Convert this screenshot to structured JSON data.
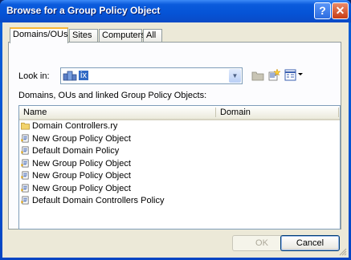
{
  "window": {
    "title": "Browse for a Group Policy Object",
    "help_button": "?",
    "close_button": "✕"
  },
  "tabs": [
    {
      "label": "Domains/OUs",
      "active": true
    },
    {
      "label": "Sites",
      "active": false
    },
    {
      "label": "Computers",
      "active": false
    },
    {
      "label": "All",
      "active": false
    }
  ],
  "look_in": {
    "label": "Look in:",
    "value": "ix"
  },
  "list_label": "Domains, OUs and linked Group Policy Objects:",
  "columns": [
    "Name",
    "Domain"
  ],
  "rows": [
    {
      "icon": "folder-icon",
      "name": "Domain Controllers.ry"
    },
    {
      "icon": "gpo-icon",
      "name": "New Group Policy Object"
    },
    {
      "icon": "gpo-icon",
      "name": "Default Domain Policy"
    },
    {
      "icon": "gpo-icon",
      "name": "New Group Policy Object"
    },
    {
      "icon": "gpo-icon",
      "name": "New Group Policy Object"
    },
    {
      "icon": "gpo-icon",
      "name": "New Group Policy Object"
    },
    {
      "icon": "gpo-icon",
      "name": "Default Domain Controllers Policy"
    }
  ],
  "buttons": {
    "ok": "OK",
    "cancel": "Cancel"
  },
  "colors": {
    "title_bar": "#0553d6",
    "dialog_face": "#ece9d8",
    "active_tab_accent": "#f8b636"
  }
}
